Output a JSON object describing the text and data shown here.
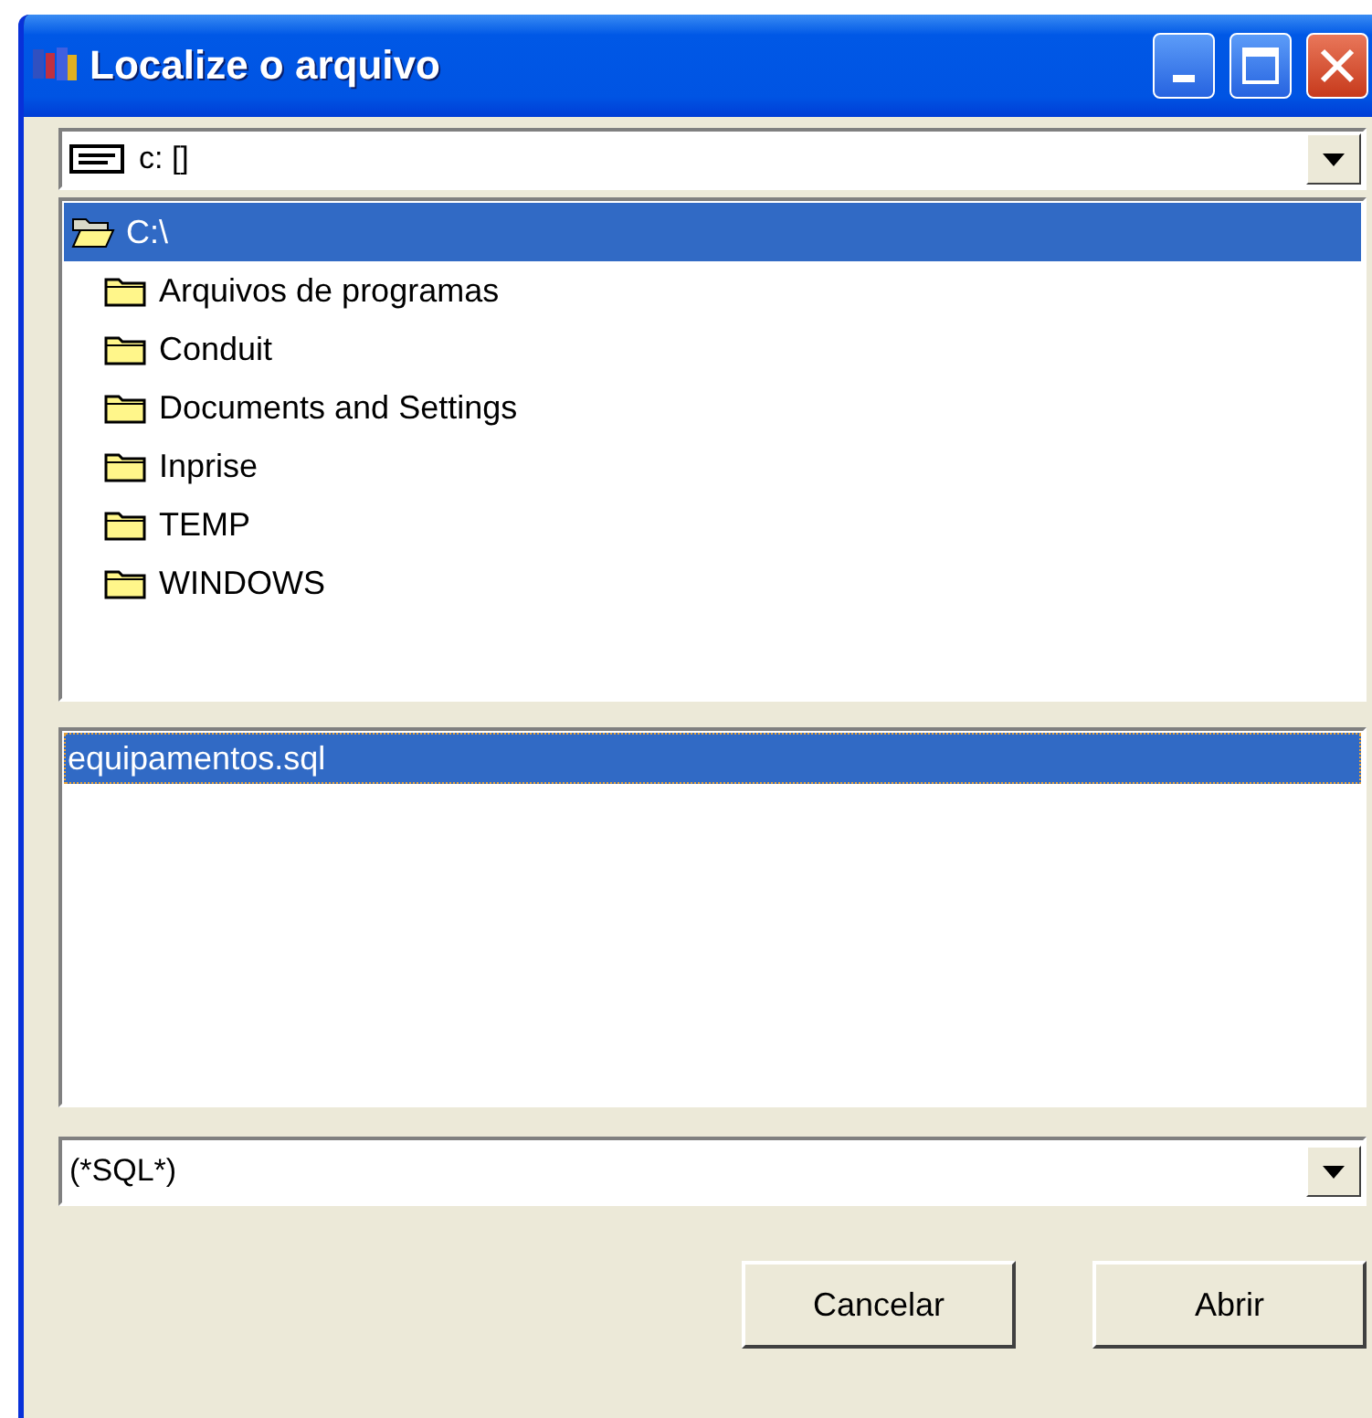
{
  "window": {
    "title": "Localize o arquivo"
  },
  "drive": {
    "value": "c: []"
  },
  "folders": [
    {
      "label": "C:\\",
      "selected": true,
      "expanded": true,
      "children": [
        {
          "label": "Arquivos de programas",
          "selected": false,
          "expanded": false
        },
        {
          "label": "Conduit",
          "selected": false,
          "expanded": false
        },
        {
          "label": "Documents and Settings",
          "selected": false,
          "expanded": false
        },
        {
          "label": "Inprise",
          "selected": false,
          "expanded": false
        },
        {
          "label": "TEMP",
          "selected": false,
          "expanded": false
        },
        {
          "label": "WINDOWS",
          "selected": false,
          "expanded": false
        }
      ]
    }
  ],
  "files": [
    {
      "name": "equipamentos.sql",
      "selected": true
    }
  ],
  "filter": {
    "value": "(*SQL*)"
  },
  "buttons": [
    "Cancelar",
    "Abrir"
  ]
}
